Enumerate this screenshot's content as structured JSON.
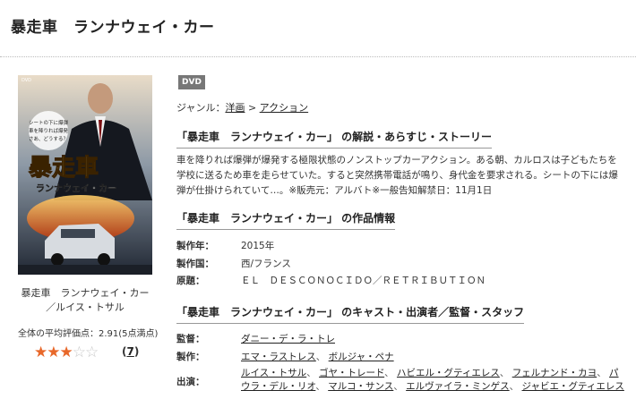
{
  "page": {
    "title": "暴走車　ランナウェイ・カー"
  },
  "product": {
    "poster_alt": "暴走車 ランナウェイ・カー",
    "poster_text": {
      "badge": "DVD",
      "tagline_1": "シートの下に爆弾",
      "tagline_2": "車を降りれば爆発",
      "tagline_3": "さあ、どうする？",
      "title_jp": "暴走車",
      "subtitle_jp": "ランナウェイ・カー"
    },
    "caption": "暴走車　ランナウェイ・カー／ルイス・トサル",
    "avg_rating_text": "全体の平均評価点：2.91(5点満点)",
    "rating_stars": {
      "value": 2.91,
      "max": 5,
      "filled": 3
    },
    "review_count": "7"
  },
  "badge": "DVD",
  "genre": {
    "label": "ジャンル：",
    "items": [
      "洋画",
      "アクション"
    ],
    "separator": " > "
  },
  "sections": {
    "synopsis_title": "「暴走車　ランナウェイ・カー」 の解説・あらすじ・ストーリー",
    "synopsis_text": "車を降りれば爆弾が爆発する極限状態のノンストップカーアクション。ある朝、カルロスは子どもたちを学校に送るため車を走らせていた。すると突然携帯電話が鳴り、身代金を要求される。シートの下には爆弾が仕掛けられていて…。※販売元：アルバト※一般告知解禁日：11月1日",
    "info_title": "「暴走車　ランナウェイ・カー」 の作品情報",
    "info": {
      "year_label": "製作年：",
      "year_value": "2015年",
      "country_label": "製作国：",
      "country_value": "西/フランス",
      "original_label": "原題：",
      "original_value": "ＥＬ　ＤＥＳＣＯＮＯＣＩＤＯ／ＲＥＴＲＩＢＵＴＩＯＮ"
    },
    "cast_title": "「暴走車　ランナウェイ・カー」 のキャスト・出演者／監督・スタッフ",
    "staff": {
      "director_label": "監督：",
      "directors": [
        "ダニー・デ・ラ・トレ"
      ],
      "producer_label": "製作：",
      "producers": [
        "エマ・ラストレス",
        "ボルジャ・ペナ"
      ],
      "cast_label": "出演：",
      "cast": [
        "ルイス・トサル",
        "ゴヤ・トレード",
        "ハビエル・グティエレス",
        "フェルナンド・カヨ",
        "パウラ・デル・リオ",
        "マルコ・サンス",
        "エルヴァイラ・ミンゲス",
        "ジャビエ・グティエレス"
      ]
    }
  },
  "colors": {
    "star": "#e8682a",
    "badge_bg": "#777777"
  }
}
